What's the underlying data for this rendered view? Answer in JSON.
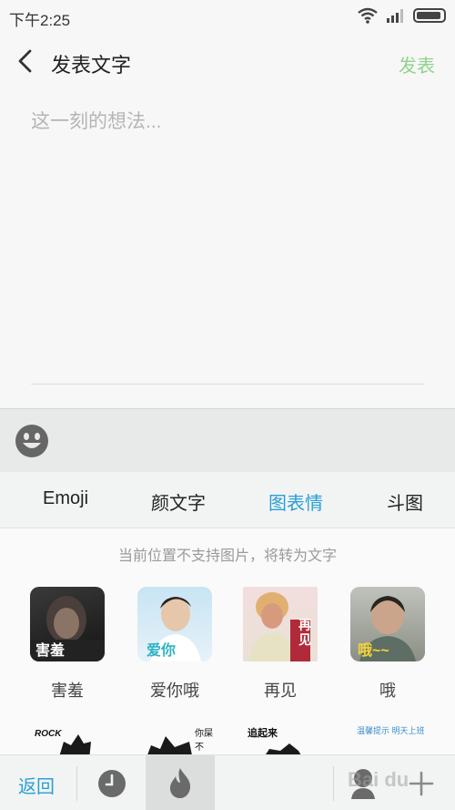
{
  "status_bar": {
    "time": "下午2:25"
  },
  "header": {
    "title": "发表文字",
    "publish_label": "发表"
  },
  "compose": {
    "placeholder": "这一刻的想法..."
  },
  "tabs": [
    {
      "label": "Emoji",
      "active": false
    },
    {
      "label": "颜文字",
      "active": false
    },
    {
      "label": "图表情",
      "active": true
    },
    {
      "label": "斗图",
      "active": false
    }
  ],
  "notice": "当前位置不支持图片，将转为文字",
  "stickers": [
    {
      "label": "害羞",
      "overlay": "害羞"
    },
    {
      "label": "爱你哦",
      "overlay": "爱你"
    },
    {
      "label": "再见",
      "overlay": "再见"
    },
    {
      "label": "哦",
      "overlay": "哦~~"
    }
  ],
  "sticker_row2_texts": [
    "ROCK",
    "你屎不",
    "追起来",
    "温馨提示 明天上班"
  ],
  "bottom_bar": {
    "back_label": "返回"
  },
  "watermark": "Bai du",
  "colors": {
    "accent": "#2a9fd6",
    "publish": "#8fd48c",
    "panel": "#f2f4f4"
  }
}
